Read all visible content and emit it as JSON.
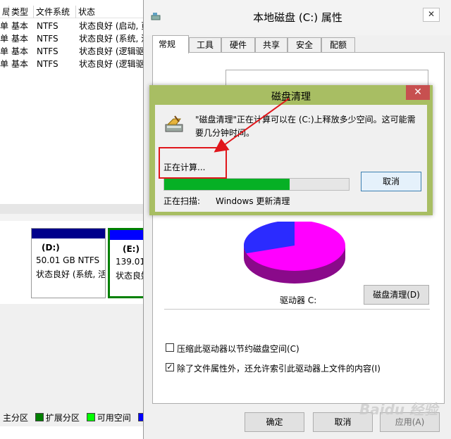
{
  "background": {
    "columns": [
      "局",
      "类型",
      "文件系统",
      "状态"
    ],
    "rows": [
      [
        "单",
        "基本",
        "NTFS",
        "状态良好 (启动, 页"
      ],
      [
        "单",
        "基本",
        "NTFS",
        "状态良好 (系统, 活"
      ],
      [
        "单",
        "基本",
        "NTFS",
        "状态良好 (逻辑驱"
      ],
      [
        "单",
        "基本",
        "NTFS",
        "状态良好 (逻辑驱"
      ]
    ],
    "partitions": [
      {
        "name": "(D:)",
        "size": "50.01 GB NTFS",
        "status": "状态良好 (系统, 活"
      },
      {
        "name": "(E:)",
        "size": "139.01",
        "status": "状态良好"
      }
    ],
    "legend": [
      {
        "label": "主分区",
        "color": "#00008b"
      },
      {
        "label": "扩展分区",
        "color": "#008000"
      },
      {
        "label": "可用空间",
        "color": "#00ff00"
      },
      {
        "label": "",
        "color": "#0000ff"
      }
    ]
  },
  "properties": {
    "title": "本地磁盘 (C:) 属性",
    "tabs": [
      "常规",
      "工具",
      "硬件",
      "共享",
      "安全",
      "配额"
    ],
    "drive_label": "驱动器 C:",
    "cleanup_button": "磁盘清理(D)",
    "compress_checkbox": {
      "label": "压缩此驱动器以节约磁盘空间(C)",
      "checked": false
    },
    "index_checkbox": {
      "label": "除了文件属性外，还允许索引此驱动器上文件的内容(I)",
      "checked": true
    },
    "ok": "确定",
    "cancel": "取消",
    "apply": "应用(A)",
    "pie": {
      "used_fraction": 0.3,
      "used_color": "#2b2bff",
      "free_color": "#ff00ff",
      "shadow_color": "#8a0a8a"
    }
  },
  "cleanup": {
    "title": "磁盘清理",
    "close_glyph": "✕",
    "message": "\"磁盘清理\"正在计算可以在 (C:)上释放多少空间。这可能需要几分钟时间。",
    "status": "正在计算...",
    "progress": 0.68,
    "cancel": "取消",
    "scan_label": "正在扫描:",
    "scan_item": "Windows 更新清理"
  },
  "watermark": "Baidu 经验",
  "accent_colors": {
    "cleanup_frame": "#a8be63",
    "progress": "#06b025",
    "annotation": "#e0161b"
  }
}
